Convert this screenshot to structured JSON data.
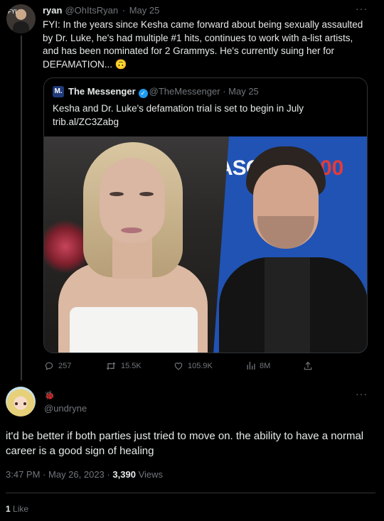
{
  "tweet": {
    "display_name": "ryan",
    "handle": "@OhItsRyan",
    "separator": "·",
    "date": "May 25",
    "more": "···",
    "avatar_tag": "FYI",
    "text": "FYI: In the years since Kesha came forward about being sexually assaulted by Dr. Luke, he's had multiple #1 hits, continues to work with a-list artists, and has been nominated for 2 Grammys. He's currently suing her for DEFAMATION... 🙃",
    "quote": {
      "logo": "M.",
      "display_name": "The Messenger",
      "verified_icon": "✓",
      "handle": "@TheMessenger",
      "separator": "·",
      "date": "May 25",
      "text_line1": "Kesha and Dr. Luke's defamation trial is set to begin in July",
      "text_line2": "trib.al/ZC3Zabg",
      "image_text_left": "ASC",
      "image_text_right": "00"
    },
    "actions": {
      "replies": "257",
      "retweets": "15.5K",
      "likes": "105.9K",
      "views": "8M"
    }
  },
  "reply": {
    "display_name": "🐞",
    "handle": "@undryne",
    "more": "···",
    "text": "it'd be better if both parties just tried to move on. the ability to have a normal career is a good sign of healing",
    "time": "3:47 PM",
    "date": "May 26, 2023",
    "separator": "·",
    "views_count": "3,390",
    "views_label": "Views",
    "likes_count": "1",
    "likes_label": "Like"
  },
  "colors": {
    "background": "#000000",
    "text": "#e7e9ea",
    "secondary": "#71767b",
    "verified": "#1d9bf0",
    "border": "#2f3336"
  }
}
